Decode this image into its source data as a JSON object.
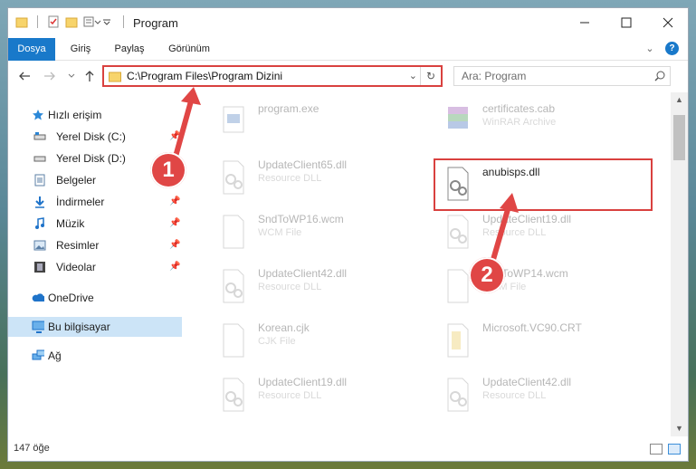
{
  "window": {
    "title": "Program",
    "controls": {
      "minimize": "–",
      "maximize": "☐",
      "close": "✕"
    }
  },
  "ribbon": {
    "tabs": [
      "Dosya",
      "Giriş",
      "Paylaş",
      "Görünüm"
    ],
    "expand_glyph": "⌄",
    "help_glyph": "?"
  },
  "address": {
    "path": "C:\\Program Files\\Program Dizini",
    "dropdown_glyph": "⌄",
    "refresh_glyph": "↻"
  },
  "search": {
    "placeholder": "Ara: Program"
  },
  "nav": {
    "quick_access": "Hızlı erişim",
    "items": [
      {
        "label": "Yerel Disk (C:)",
        "icon": "drive-icon",
        "pinned": true
      },
      {
        "label": "Yerel Disk (D:)",
        "icon": "drive-icon",
        "pinned": false
      },
      {
        "label": "Belgeler",
        "icon": "documents-icon",
        "pinned": true
      },
      {
        "label": "İndirmeler",
        "icon": "downloads-icon",
        "pinned": true
      },
      {
        "label": "Müzik",
        "icon": "music-icon",
        "pinned": true
      },
      {
        "label": "Resimler",
        "icon": "pictures-icon",
        "pinned": true
      },
      {
        "label": "Videolar",
        "icon": "videos-icon",
        "pinned": true
      }
    ],
    "onedrive": "OneDrive",
    "this_pc": "Bu bilgisayar",
    "network": "Ağ"
  },
  "files": [
    {
      "name": "program.exe",
      "type": "",
      "icon": "exe-icon"
    },
    {
      "name": "certificates.cab",
      "type": "WinRAR Archive",
      "icon": "archive-icon"
    },
    {
      "name": "UpdateClient65.dll",
      "type": "Resource DLL",
      "icon": "dll-icon"
    },
    {
      "name": "anubisps.dll",
      "type": "",
      "icon": "dll-icon"
    },
    {
      "name": "SndToWP16.wcm",
      "type": "WCM File",
      "icon": "blank-file-icon"
    },
    {
      "name": "UpdateClient19.dll",
      "type": "Resource DLL",
      "icon": "dll-icon"
    },
    {
      "name": "UpdateClient42.dll",
      "type": "Resource DLL",
      "icon": "dll-icon"
    },
    {
      "name": "SndToWP14.wcm",
      "type": "WCM File",
      "icon": "blank-file-icon"
    },
    {
      "name": "Korean.cjk",
      "type": "CJK File",
      "icon": "blank-file-icon"
    },
    {
      "name": "Microsoft.VC90.CRT",
      "type": "",
      "icon": "folder-file-icon"
    },
    {
      "name": "UpdateClient19.dll",
      "type": "Resource DLL",
      "icon": "dll-icon"
    },
    {
      "name": "UpdateClient42.dll",
      "type": "Resource DLL",
      "icon": "dll-icon"
    }
  ],
  "status": {
    "count": "147 öğe"
  },
  "annotations": {
    "step1": "1",
    "step2": "2"
  },
  "colors": {
    "accent": "#1979ca",
    "highlight": "#d9413f",
    "selection": "#cce4f7"
  }
}
